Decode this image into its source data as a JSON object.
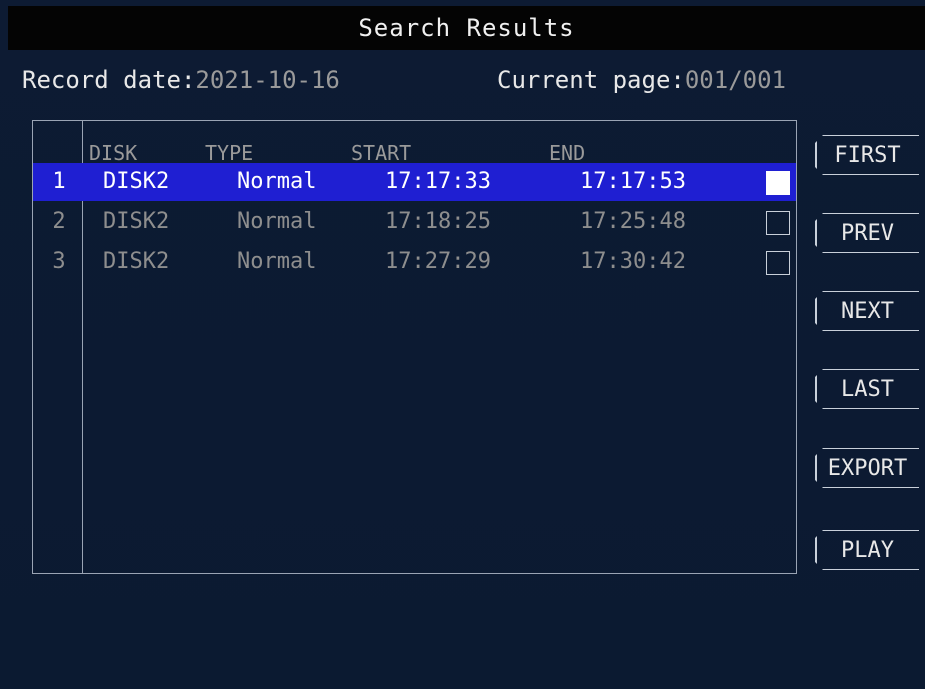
{
  "window": {
    "title": "Search Results"
  },
  "info": {
    "record_date_label": "Record date:",
    "record_date_value": "2021-10-16",
    "current_page_label": "Current page:",
    "current_page_value": "001/001"
  },
  "table": {
    "headers": [
      "DISK",
      "TYPE",
      "START",
      "END"
    ],
    "rows": [
      {
        "index": "1",
        "disk": "DISK2",
        "type": "Normal",
        "start": "17:17:33",
        "end": "17:17:53",
        "checked": true,
        "selected": true
      },
      {
        "index": "2",
        "disk": "DISK2",
        "type": "Normal",
        "start": "17:18:25",
        "end": "17:25:48",
        "checked": false,
        "selected": false
      },
      {
        "index": "3",
        "disk": "DISK2",
        "type": "Normal",
        "start": "17:27:29",
        "end": "17:30:42",
        "checked": false,
        "selected": false
      }
    ]
  },
  "buttons": {
    "first": "FIRST",
    "prev": "PREV",
    "next": "NEXT",
    "last": "LAST",
    "export": "EXPORT",
    "play": "PLAY"
  },
  "colors": {
    "background": "#0c1a30",
    "titlebar": "#040404",
    "selected_row": "#1f1fd2"
  }
}
